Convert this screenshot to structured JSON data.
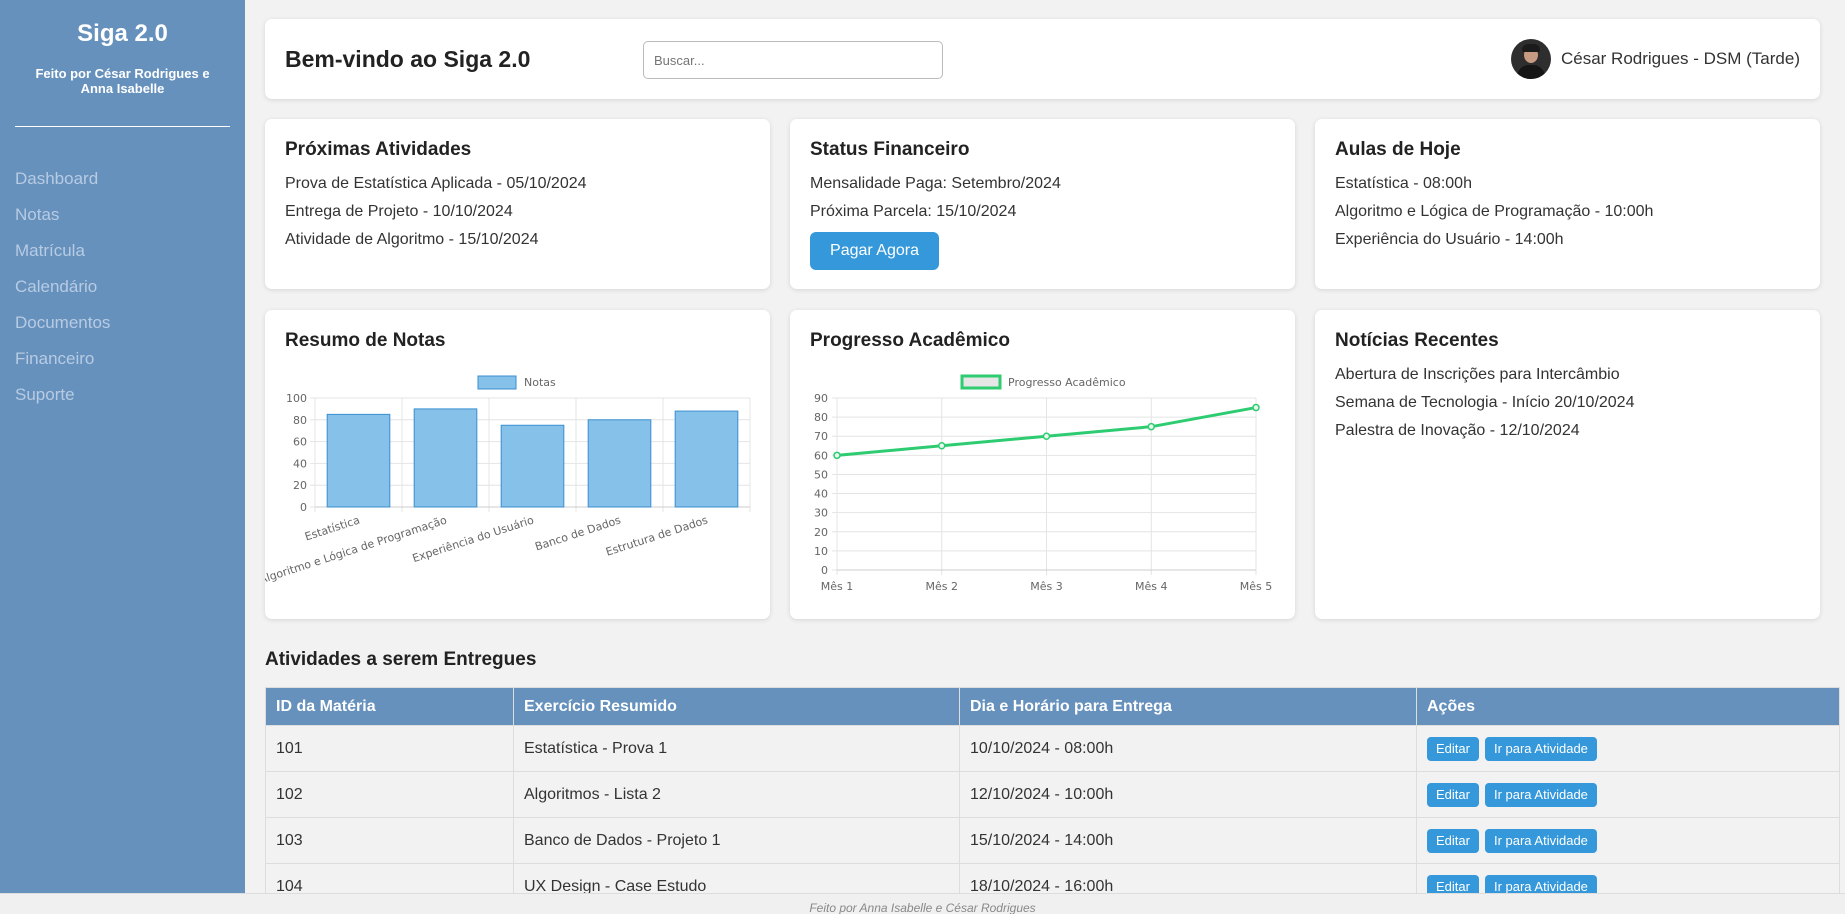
{
  "sidebar": {
    "brand": "Siga 2.0",
    "credits": "Feito por César Rodrigues e Anna Isabelle",
    "items": [
      {
        "label": "Dashboard"
      },
      {
        "label": "Notas"
      },
      {
        "label": "Matrícula"
      },
      {
        "label": "Calendário"
      },
      {
        "label": "Documentos"
      },
      {
        "label": "Financeiro"
      },
      {
        "label": "Suporte"
      }
    ]
  },
  "header": {
    "title": "Bem-vindo ao Siga 2.0",
    "search_placeholder": "Buscar...",
    "user": "César Rodrigues - DSM (Tarde)"
  },
  "cards": {
    "atividades": {
      "title": "Próximas Atividades",
      "items": [
        "Prova de Estatística Aplicada - 05/10/2024",
        "Entrega de Projeto - 10/10/2024",
        "Atividade de Algoritmo - 15/10/2024"
      ]
    },
    "financeiro": {
      "title": "Status Financeiro",
      "items": [
        "Mensalidade Paga: Setembro/2024",
        "Próxima Parcela: 15/10/2024"
      ],
      "button": "Pagar Agora"
    },
    "aulas": {
      "title": "Aulas de Hoje",
      "items": [
        "Estatística - 08:00h",
        "Algoritmo e Lógica de Programação - 10:00h",
        "Experiência do Usuário - 14:00h"
      ]
    },
    "notas": {
      "title": "Resumo de Notas"
    },
    "progresso": {
      "title": "Progresso Acadêmico"
    },
    "noticias": {
      "title": "Notícias Recentes",
      "items": [
        "Abertura de Inscrições para Intercâmbio",
        "Semana de Tecnologia - Início 20/10/2024",
        "Palestra de Inovação - 12/10/2024"
      ]
    }
  },
  "chart_data": [
    {
      "type": "bar",
      "categories": [
        "Estatística",
        "Algoritmo e Lógica de Programação",
        "Experiência do Usuário",
        "Banco de Dados",
        "Estrutura de Dados"
      ],
      "series": [
        {
          "name": "Notas",
          "values": [
            85,
            90,
            75,
            80,
            88
          ]
        }
      ],
      "ylim": [
        0,
        100
      ],
      "yticks": [
        0,
        20,
        40,
        60,
        80,
        100
      ],
      "legend": "top",
      "grid": true,
      "color": "#85c1e9",
      "stroke": "#3a8fd0"
    },
    {
      "type": "line",
      "categories": [
        "Mês 1",
        "Mês 2",
        "Mês 3",
        "Mês 4",
        "Mês 5"
      ],
      "series": [
        {
          "name": "Progresso Acadêmico",
          "values": [
            60,
            65,
            70,
            75,
            85
          ]
        }
      ],
      "ylim": [
        0,
        90
      ],
      "yticks": [
        0,
        10,
        20,
        30,
        40,
        50,
        60,
        70,
        80,
        90
      ],
      "legend": "top",
      "grid": true,
      "color": "#2ecc71"
    }
  ],
  "table": {
    "title": "Atividades a serem Entregues",
    "headers": [
      "ID da Matéria",
      "Exercício Resumido",
      "Dia e Horário para Entrega",
      "Ações"
    ],
    "rows": [
      [
        "101",
        "Estatística - Prova 1",
        "10/10/2024 - 08:00h"
      ],
      [
        "102",
        "Algoritmos - Lista 2",
        "12/10/2024 - 10:00h"
      ],
      [
        "103",
        "Banco de Dados - Projeto 1",
        "15/10/2024 - 14:00h"
      ],
      [
        "104",
        "UX Design - Case Estudo",
        "18/10/2024 - 16:00h"
      ]
    ],
    "edit_label": "Editar",
    "go_label": "Ir para Atividade"
  },
  "footer": "Feito por Anna Isabelle e César Rodrigues"
}
